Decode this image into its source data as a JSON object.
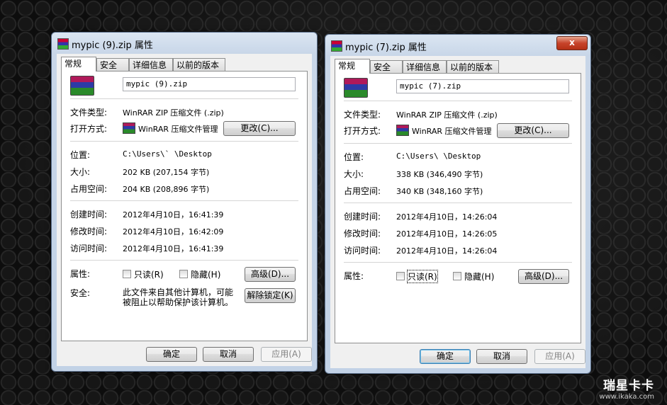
{
  "left": {
    "title": "mypic (9).zip 属性",
    "tabs": [
      "常规",
      "安全",
      "详细信息",
      "以前的版本"
    ],
    "filename": "mypic (9).zip",
    "labels": {
      "type": "文件类型:",
      "open_with": "打开方式:",
      "location": "位置:",
      "size": "大小:",
      "size_on_disk": "占用空间:",
      "created": "创建时间:",
      "modified": "修改时间:",
      "accessed": "访问时间:",
      "attributes": "属性:",
      "security": "安全:"
    },
    "values": {
      "type": "WinRAR ZIP 压缩文件 (.zip)",
      "open_with": "WinRAR 压缩文件管理",
      "location": "C:\\Users\\`      \\Desktop",
      "size": "202 KB (207,154 字节)",
      "size_on_disk": "204 KB (208,896 字节)",
      "created": "2012年4月10日，16:41:39",
      "modified": "2012年4月10日，16:42:09",
      "accessed": "2012年4月10日，16:41:39",
      "security_line1": "此文件来自其他计算机，可能",
      "security_line2": "被阻止以帮助保护该计算机。"
    },
    "buttons": {
      "change": "更改(C)...",
      "advanced": "高级(D)...",
      "unblock": "解除锁定(K)",
      "ok": "确定",
      "cancel": "取消",
      "apply": "应用(A)"
    },
    "checkboxes": {
      "readonly": "只读(R)",
      "hidden": "隐藏(H)"
    }
  },
  "right": {
    "title": "mypic (7).zip 属性",
    "close_label": "x",
    "tabs": [
      "常规",
      "安全",
      "详细信息",
      "以前的版本"
    ],
    "filename": "mypic (7).zip",
    "labels": {
      "type": "文件类型:",
      "open_with": "打开方式:",
      "location": "位置:",
      "size": "大小:",
      "size_on_disk": "占用空间:",
      "created": "创建时间:",
      "modified": "修改时间:",
      "accessed": "访问时间:",
      "attributes": "属性:"
    },
    "values": {
      "type": "WinRAR ZIP 压缩文件 (.zip)",
      "open_with": "WinRAR 压缩文件管理",
      "location": "C:\\Users\\      \\Desktop",
      "size": "338 KB (346,490 字节)",
      "size_on_disk": "340 KB (348,160 字节)",
      "created": "2012年4月10日，14:26:04",
      "modified": "2012年4月10日，14:26:05",
      "accessed": "2012年4月10日，14:26:04"
    },
    "buttons": {
      "change": "更改(C)...",
      "advanced": "高级(D)...",
      "ok": "确定",
      "cancel": "取消",
      "apply": "应用(A)"
    },
    "checkboxes": {
      "readonly": "只读(R)",
      "hidden": "隐藏(H)"
    }
  },
  "watermark": {
    "brand": "瑞星卡卡",
    "url": "www.ikaka.com"
  }
}
